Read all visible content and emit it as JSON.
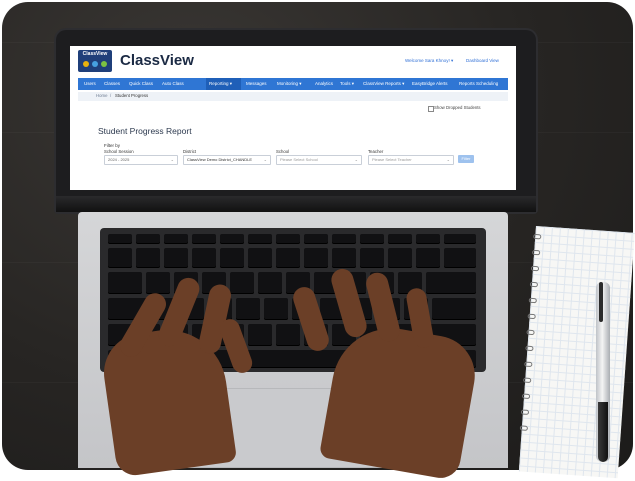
{
  "app": {
    "logo_text": "ClassView",
    "title": "ClassView",
    "welcome": "Welcome Sara Khnoy! ▾",
    "dashboard_link": "Dashboard View"
  },
  "nav": {
    "items": [
      {
        "label": "Users"
      },
      {
        "label": "Classes"
      },
      {
        "label": "Quick Class"
      },
      {
        "label": "Auto Class"
      },
      {
        "label": "Reporting ▾"
      },
      {
        "label": "Messages"
      },
      {
        "label": "Monitoring ▾"
      },
      {
        "label": "Analytics"
      },
      {
        "label": "Tools ▾"
      },
      {
        "label": "ClassView Reports ▾"
      },
      {
        "label": "EasyBridge Alerts"
      },
      {
        "label": "Reports Scheduling"
      }
    ],
    "active_index": 4
  },
  "breadcrumb": {
    "home": "Home",
    "separator": "/",
    "current": "Student Progress"
  },
  "options": {
    "show_dropped_label": "Show Dropped Students"
  },
  "report": {
    "title": "Student Progress Report",
    "filter_by": "Filter by",
    "fields": [
      {
        "label": "School Session",
        "value": "2024 - 2025"
      },
      {
        "label": "District",
        "value": "ClassView Demo District_CHANDLE"
      },
      {
        "label": "School",
        "value": "Please Select School"
      },
      {
        "label": "Teacher",
        "value": "Please Select Teacher"
      }
    ],
    "go_label": "Filter"
  },
  "colors": {
    "navbar": "#2f76d4",
    "accent_link": "#2f6fd6",
    "title_text": "#1b2a44",
    "skin": "#6b3f27"
  }
}
